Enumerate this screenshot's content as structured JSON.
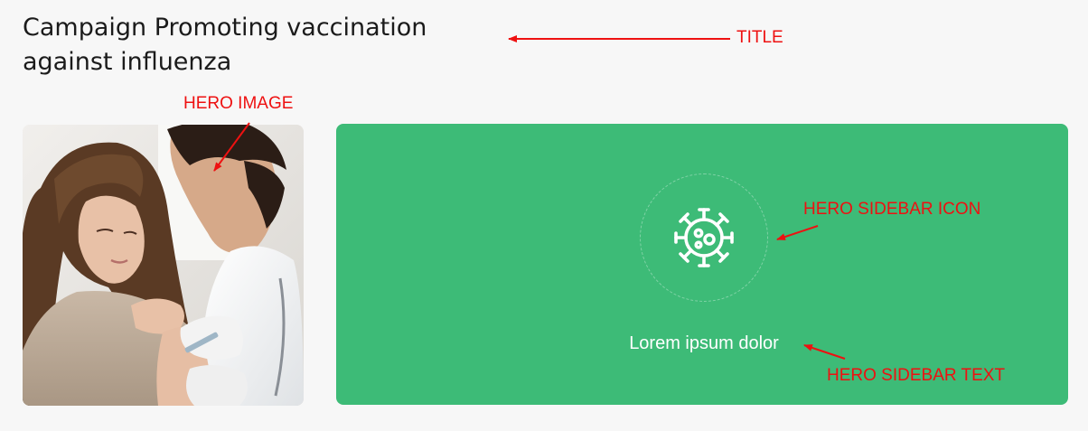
{
  "page": {
    "title": "Campaign Promoting vaccination against influenza"
  },
  "hero_image": {
    "alt": "Doctor vaccinating a young woman in the shoulder"
  },
  "hero_sidebar": {
    "icon": "virus-icon",
    "text": "Lorem ipsum dolor",
    "background_color": "#3dbb77"
  },
  "annotations": {
    "title": "TITLE",
    "hero_image": "HERO IMAGE",
    "hero_sidebar_icon": "HERO SIDEBAR ICON",
    "hero_sidebar_text": "HERO SIDEBAR TEXT",
    "color": "#ee1111"
  }
}
